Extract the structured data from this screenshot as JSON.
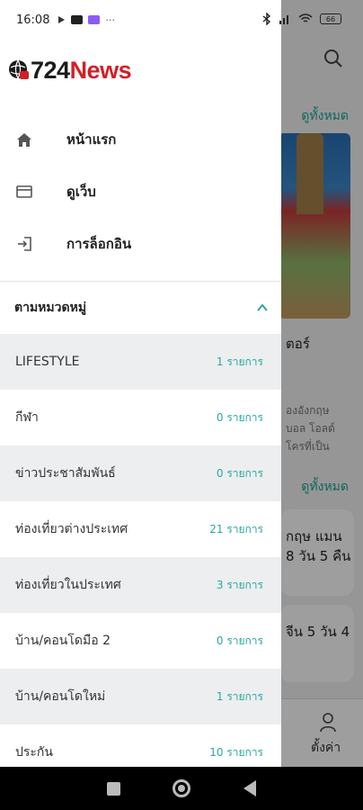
{
  "status_bar": {
    "time": "16:08",
    "battery": "66"
  },
  "logo": {
    "number": "724",
    "word": "News"
  },
  "menu": [
    {
      "label": "หน้าแรก",
      "icon": "home-icon"
    },
    {
      "label": "ดูเว็บ",
      "icon": "browser-icon"
    },
    {
      "label": "การล็อกอิน",
      "icon": "login-icon"
    }
  ],
  "categories_section": {
    "title": "ตามหมวดหมู่",
    "expanded": true
  },
  "categories": [
    {
      "name": "LIFESTYLE",
      "count": "1 รายการ"
    },
    {
      "name": "กีฬา",
      "count": "0 รายการ"
    },
    {
      "name": "ข่าวประชาสัมพันธ์",
      "count": "0 รายการ"
    },
    {
      "name": "ท่องเที่ยวต่างประเทศ",
      "count": "21 รายการ"
    },
    {
      "name": "ท่องเที่ยวในประเทศ",
      "count": "3 รายการ"
    },
    {
      "name": "บ้าน/คอนโดมือ 2",
      "count": "0 รายการ"
    },
    {
      "name": "บ้าน/คอนโดใหม่",
      "count": "1 รายการ"
    },
    {
      "name": "ประกัน",
      "count": "10 รายการ"
    }
  ],
  "background": {
    "view_all_1": "ดูทั้งหมด",
    "view_all_2": "ดูทั้งหมด",
    "headline_fragment": "ตอร์",
    "snippet_line1": "องอังกฤษ",
    "snippet_line2": "บอล โอลด์",
    "snippet_line3": "โครที่เป็น",
    "card1_line1": "กฤษ แมน",
    "card1_line2": "8 วัน 5 คืน",
    "card2_line1": "จีน 5 วัน 4",
    "card2_line2": "",
    "settings_label": "ตั้งค่า"
  },
  "colors": {
    "accent": "#28a89d",
    "logo_red": "#d41f26",
    "shaded_row": "#eceef0"
  }
}
